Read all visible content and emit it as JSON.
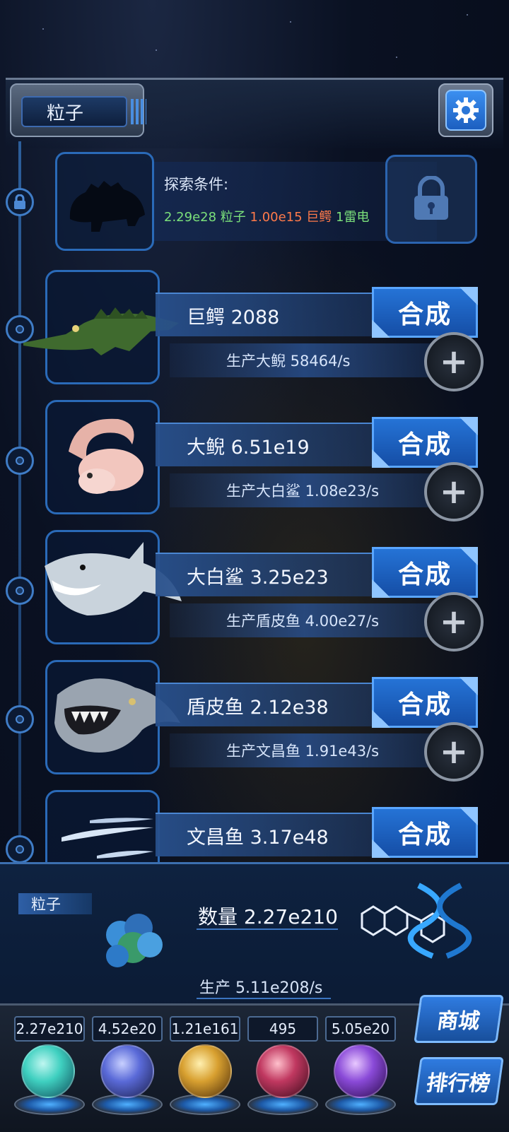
{
  "header": {
    "title": "粒子"
  },
  "locked": {
    "label": "探索条件:",
    "cond_1": "2.29e28 粒子",
    "cond_2": "1.00e15 巨鳄",
    "cond_3": "1雷电"
  },
  "creatures": [
    {
      "name_line": "巨鳄 2088",
      "merge_label": "合成",
      "prod_line": "生产大鲵 58464/s"
    },
    {
      "name_line": "大鲵 6.51e19",
      "merge_label": "合成",
      "prod_line": "生产大白鲨 1.08e23/s"
    },
    {
      "name_line": "大白鲨 3.25e23",
      "merge_label": "合成",
      "prod_line": "生产盾皮鱼 4.00e27/s"
    },
    {
      "name_line": "盾皮鱼 2.12e38",
      "merge_label": "合成",
      "prod_line": "生产文昌鱼 1.91e43/s"
    },
    {
      "name_line": "文昌鱼 3.17e48",
      "merge_label": "合成"
    }
  ],
  "particle_panel": {
    "label": "粒子",
    "count_line": "数量 2.27e210",
    "prod_line": "生产 5.11e208/s"
  },
  "resources": [
    {
      "value": "2.27e210",
      "orb": "particle-orb-icon",
      "color": "#3fd0c0"
    },
    {
      "value": "4.52e20",
      "orb": "lightning-orb-icon",
      "color": "#5a6ad8"
    },
    {
      "value": "1.21e161",
      "orb": "fire-orb-icon",
      "color": "#d8a030"
    },
    {
      "value": "495",
      "orb": "brain-orb-icon",
      "color": "#c03860"
    },
    {
      "value": "5.05e20",
      "orb": "vortex-orb-icon",
      "color": "#8a4ad8"
    }
  ],
  "side_buttons": {
    "shop": "商城",
    "ranking": "排行榜"
  },
  "colors": {
    "accent": "#2573d6",
    "green": "#7be07b",
    "orange": "#ff7a4a"
  }
}
